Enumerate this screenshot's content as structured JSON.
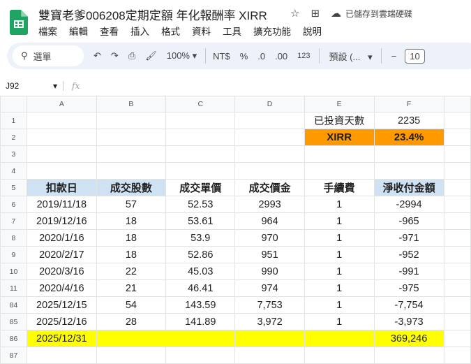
{
  "app": {
    "title": "雙寶老爹006208定期定額 年化報酬率 XIRR",
    "saved_status": "已儲存到雲端硬碟"
  },
  "menu": [
    "檔案",
    "編輯",
    "查看",
    "插入",
    "格式",
    "資料",
    "工具",
    "擴充功能",
    "說明"
  ],
  "toolbar": {
    "search": "選單",
    "zoom": "100%",
    "currency": "NT$",
    "percent": "%",
    "dec_decrease": ".0",
    "dec_increase": ".00",
    "number_format": "123",
    "font": "預設 (...",
    "font_size": "10"
  },
  "formula_bar": {
    "cell_ref": "J92",
    "fx": "fx"
  },
  "columns": [
    "A",
    "B",
    "C",
    "D",
    "E",
    "F"
  ],
  "summary": {
    "days_label": "已投資天數",
    "days_value": "2235",
    "xirr_label": "XIRR",
    "xirr_value": "23.4%"
  },
  "table": {
    "headers": [
      "扣款日",
      "成交股數",
      "成交單價",
      "成交價金",
      "手續費",
      "淨收付金額"
    ],
    "rows": [
      {
        "row": "6",
        "cells": [
          "2019/11/18",
          "57",
          "52.53",
          "2993",
          "1",
          "-2994"
        ]
      },
      {
        "row": "7",
        "cells": [
          "2019/12/16",
          "18",
          "53.61",
          "964",
          "1",
          "-965"
        ]
      },
      {
        "row": "8",
        "cells": [
          "2020/1/16",
          "18",
          "53.9",
          "970",
          "1",
          "-971"
        ]
      },
      {
        "row": "9",
        "cells": [
          "2020/2/17",
          "18",
          "52.86",
          "951",
          "1",
          "-952"
        ]
      },
      {
        "row": "10",
        "cells": [
          "2020/3/16",
          "22",
          "45.03",
          "990",
          "1",
          "-991"
        ]
      },
      {
        "row": "11",
        "cells": [
          "2020/4/16",
          "21",
          "46.41",
          "974",
          "1",
          "-975"
        ]
      },
      {
        "row": "84",
        "cells": [
          "2025/12/15",
          "54",
          "143.59",
          "7,753",
          "1",
          "-7,754"
        ]
      },
      {
        "row": "85",
        "cells": [
          "2025/12/16",
          "28",
          "141.89",
          "3,972",
          "1",
          "-3,973"
        ]
      }
    ],
    "final": {
      "row": "86",
      "date": "2025/12/31",
      "value": "369,246"
    }
  },
  "row_numbers": [
    "1",
    "2",
    "3",
    "4",
    "5",
    "87"
  ]
}
